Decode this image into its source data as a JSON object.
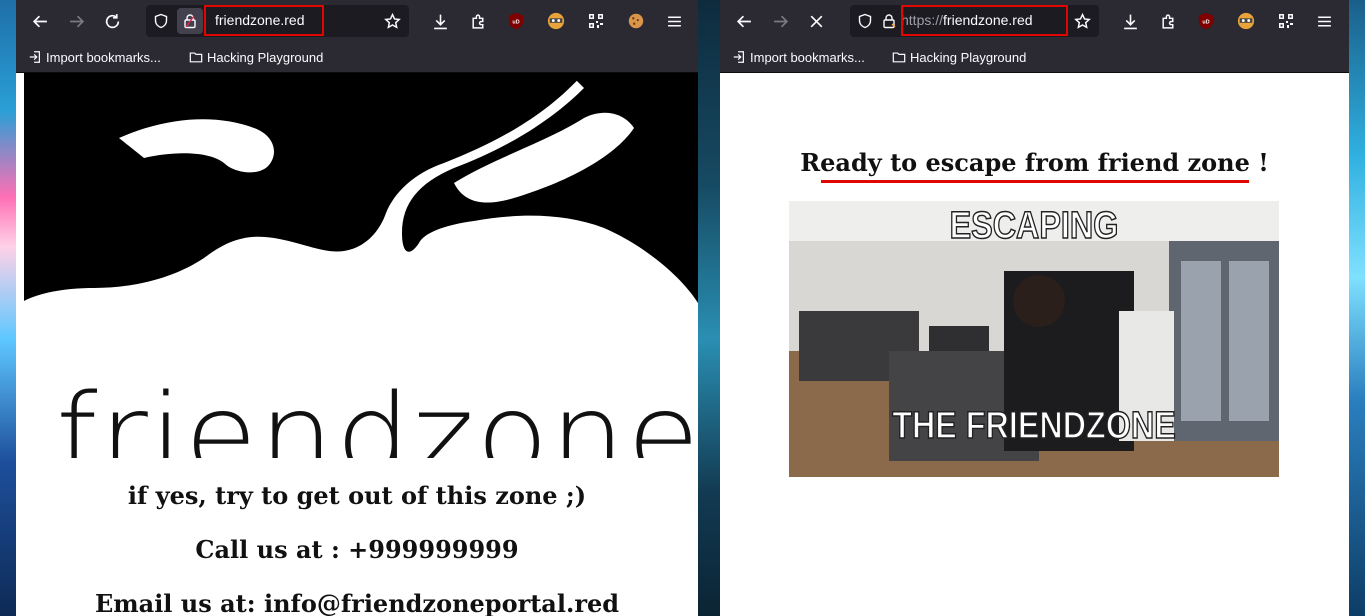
{
  "left_window": {
    "url": "friendzone.red",
    "bookmarks": [
      "Import bookmarks...",
      "Hacking Playground"
    ],
    "page": {
      "brand_text": "friendzone",
      "lines": [
        "if yes, try to get out of this zone ;)",
        "Call us at : +999999999",
        "Email us at: info@friendzoneportal.red"
      ]
    }
  },
  "right_window": {
    "url_protocol": "https://",
    "url_host": "friendzone.red",
    "bookmarks": [
      "Import bookmarks...",
      "Hacking Playground"
    ],
    "page": {
      "heading": "Ready to escape from friend zone !",
      "gif_top_caption": "ESCAPING",
      "gif_bottom_caption": "THE FRIENDZONE"
    }
  },
  "colors": {
    "toolbar": "#2b2a33",
    "urlbar": "#1c1b22",
    "highlight": "#e10600"
  },
  "icons": [
    "back-icon",
    "forward-icon",
    "reload-icon",
    "stop-icon",
    "shield-icon",
    "lock-icon",
    "star-icon",
    "download-icon",
    "extensions-icon",
    "ublock-icon",
    "privacy-badger-icon",
    "qr-icon",
    "cookie-icon",
    "menu-icon",
    "import-icon",
    "folder-icon"
  ]
}
